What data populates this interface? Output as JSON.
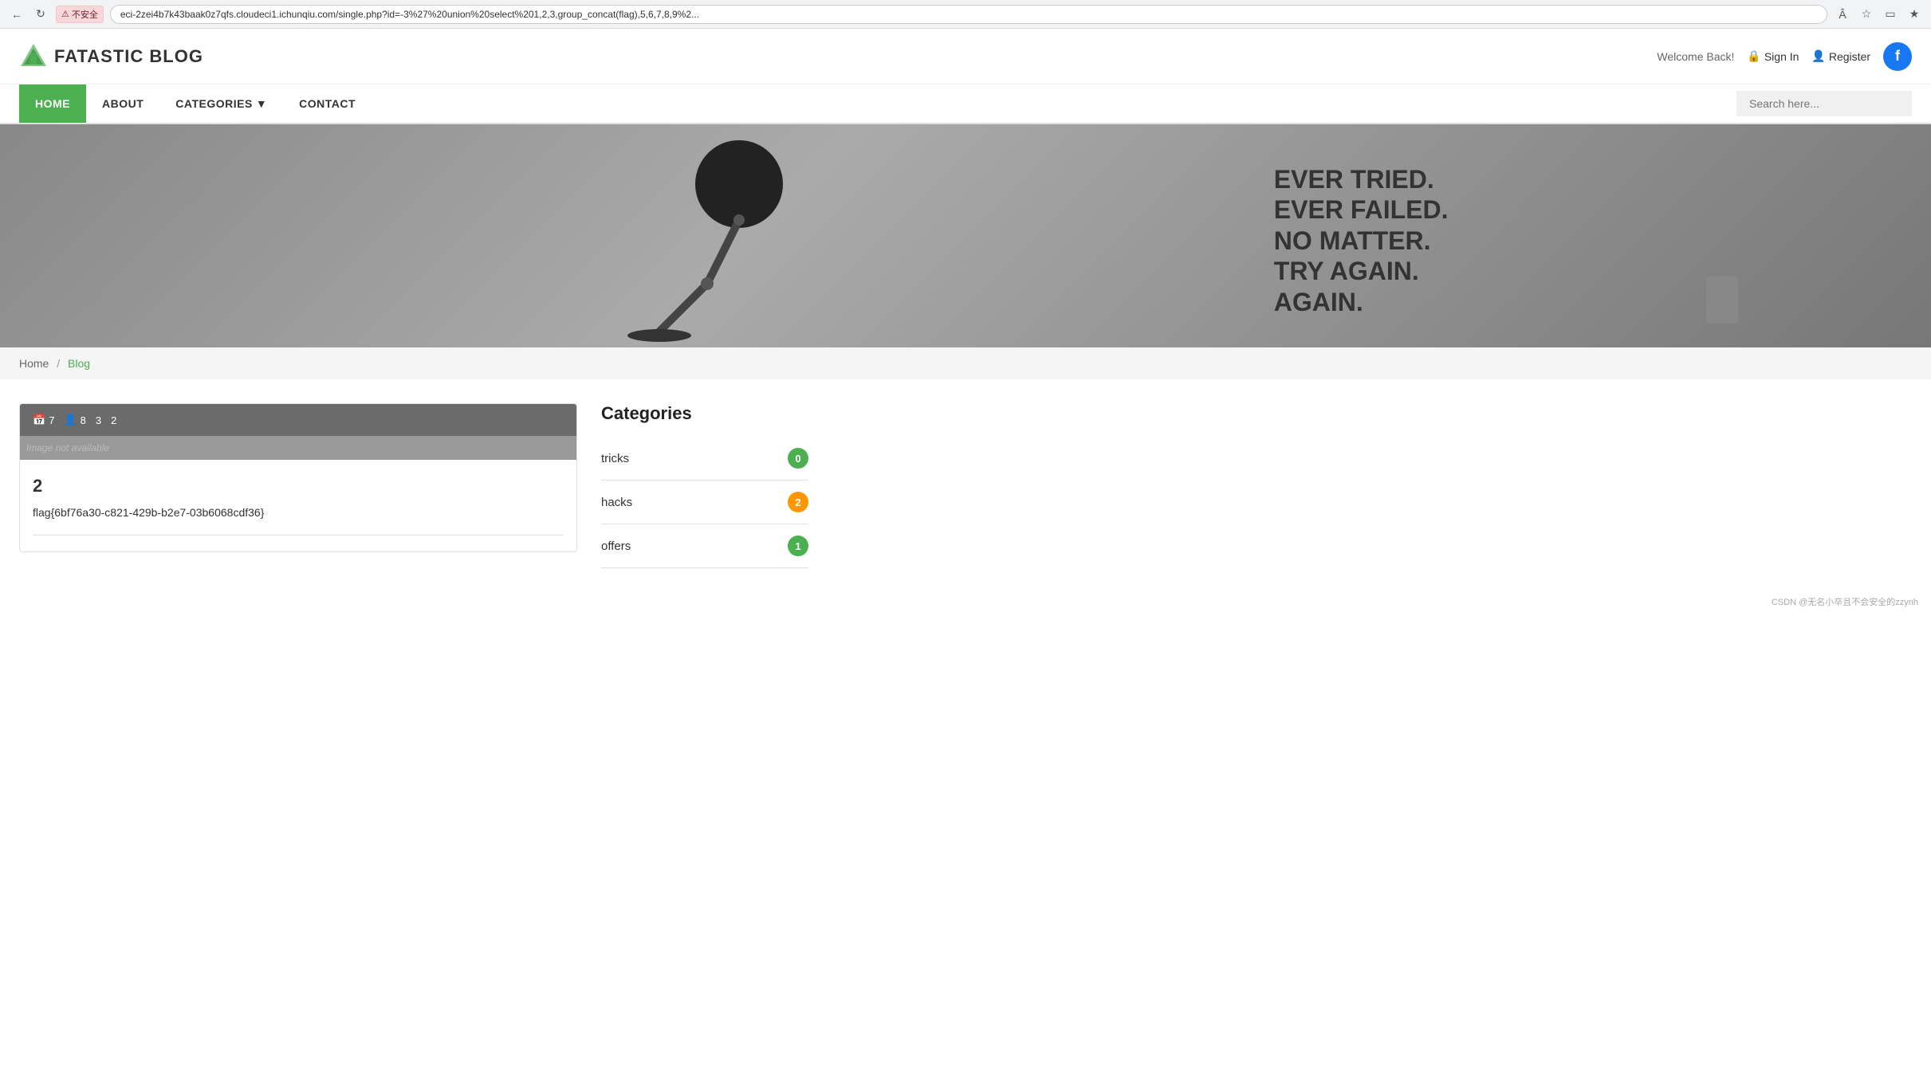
{
  "browser": {
    "url": "eci-2zei4b7k43baak0z7qfs.cloudeci1.ichunqiu.com/single.php?id=-3%27%20union%20select%201,2,3,group_concat(flag),5,6,7,8,9%2...",
    "security_label": "不安全",
    "warning_icon": "⚠"
  },
  "site": {
    "logo_text": "FATASTIC BLOG",
    "welcome": "Welcome Back!",
    "sign_in": "Sign In",
    "register": "Register",
    "fb_letter": "f"
  },
  "nav": {
    "items": [
      {
        "label": "HOME",
        "active": true
      },
      {
        "label": "ABOUT",
        "active": false
      },
      {
        "label": "CATEGORIES",
        "active": false,
        "has_dropdown": true
      },
      {
        "label": "CONTACT",
        "active": false
      }
    ],
    "search_placeholder": "Search here..."
  },
  "hero": {
    "text_line1": "EVER TRIED.",
    "text_line2": "EVER FAILED.",
    "text_line3": "NO MATTER.",
    "text_line4": "TRY AGAIN.",
    "text_line5": "AGAIN."
  },
  "breadcrumb": {
    "home": "Home",
    "separator": "/",
    "current": "Blog"
  },
  "post": {
    "meta_date_icon": "📅",
    "meta_date": "7",
    "meta_user_icon": "👤",
    "meta_user": "8",
    "meta_comments": "3",
    "meta_views": "2",
    "img_alt": "Image not available",
    "title": "2",
    "flag": "flag{6bf76a30-c821-429b-b2e7-03b6068cdf36}"
  },
  "sidebar": {
    "title": "Categories",
    "categories": [
      {
        "name": "tricks",
        "count": "0",
        "badge_color": "green"
      },
      {
        "name": "hacks",
        "count": "2",
        "badge_color": "orange"
      },
      {
        "name": "offers",
        "count": "1",
        "badge_color": "green"
      }
    ]
  },
  "footer": {
    "csdn_note": "CSDN @无名小卒且不会安全的zzynh"
  }
}
